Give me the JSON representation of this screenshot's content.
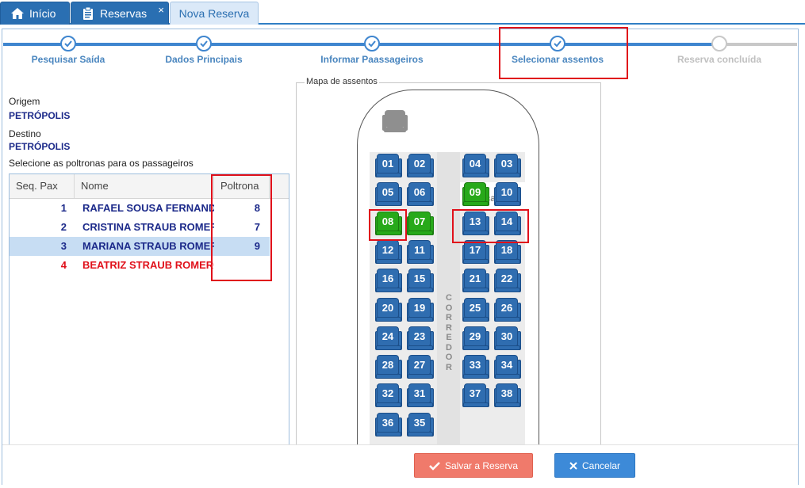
{
  "tabs": [
    {
      "label": "Início",
      "icon": "home-icon"
    },
    {
      "label": "Reservas",
      "icon": "clipboard-icon",
      "close": "×"
    },
    {
      "label": "Nova Reserva"
    }
  ],
  "steps": [
    {
      "label": "Pesquisar Saída",
      "status": "done"
    },
    {
      "label": "Dados Principais",
      "status": "done"
    },
    {
      "label": "Informar Paassageiros",
      "status": "done"
    },
    {
      "label": "Selecionar assentos",
      "status": "current"
    },
    {
      "label": "Reserva concluída",
      "status": "pending"
    }
  ],
  "trip": {
    "origem_label": "Origem",
    "origem_value": "PETRÓPOLIS",
    "destino_label": "Destino",
    "destino_value": "PETRÓPOLIS",
    "instruction": "Selecione as poltronas para os passageiros"
  },
  "grid": {
    "headers": [
      "Seq. Pax",
      "Nome",
      "Poltrona"
    ],
    "rows": [
      {
        "seq": "1",
        "nome": "RAFAEL SOUSA FERNANDES",
        "poltrona": "8",
        "color": "#1c2a8a"
      },
      {
        "seq": "2",
        "nome": "CRISTINA STRAUB ROMERO",
        "poltrona": "7",
        "color": "#1c2a8a"
      },
      {
        "seq": "3",
        "nome": "MARIANA STRAUB ROMERO",
        "poltrona": "9",
        "color": "#1c2a8a",
        "selected": true
      },
      {
        "seq": "4",
        "nome": "BEATRIZ STRAUB ROMERO",
        "poltrona": "",
        "color": "#e0101a"
      }
    ]
  },
  "seatmap": {
    "legend": "Mapa de assentos",
    "corredor": "CORREDOR",
    "escada": "Escada",
    "seats": [
      "01",
      "02",
      "04",
      "03",
      "05",
      "06",
      "09",
      "10",
      "08",
      "07",
      "13",
      "14",
      "12",
      "11",
      "17",
      "18",
      "16",
      "15",
      "21",
      "22",
      "20",
      "19",
      "25",
      "26",
      "24",
      "23",
      "29",
      "30",
      "28",
      "27",
      "33",
      "34",
      "32",
      "31",
      "37",
      "38",
      "36",
      "35"
    ],
    "selected_seats": [
      "09",
      "08",
      "07"
    ],
    "seat_color": "#2f6db0",
    "selected_color": "#27a91a"
  },
  "footer": {
    "save_label": "Salvar a Reserva",
    "cancel_label": "Cancelar"
  }
}
